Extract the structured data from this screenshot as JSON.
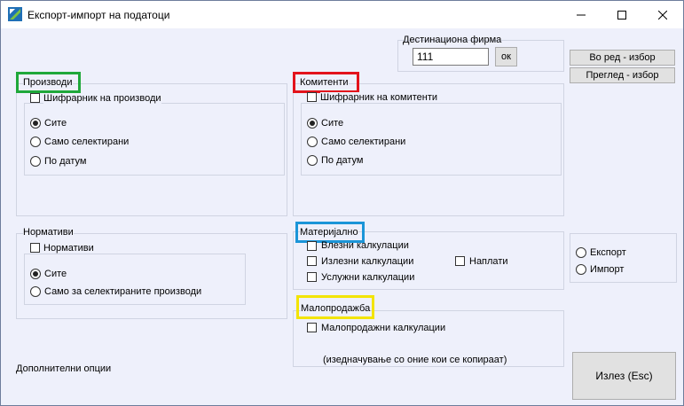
{
  "window": {
    "title": "Експорт-импорт на податоци",
    "icon": "app-logo-icon"
  },
  "destination": {
    "label": "Дестинациона фирма",
    "value": "111",
    "ok_label": "ок"
  },
  "side_buttons": {
    "row_select": "Во ред - избор",
    "preview_select": "Преглед - избор"
  },
  "products": {
    "title": "Производи",
    "checkbox": "Шифрарник на производи",
    "options": [
      "Сите",
      "Само селектирани",
      "По датум"
    ],
    "selected": "Сите"
  },
  "partners": {
    "title": "Комитенти",
    "checkbox": "Шифрарник на комитенти",
    "options": [
      "Сите",
      "Само селектирани",
      "По датум"
    ],
    "selected": "Сите"
  },
  "norms": {
    "title": "Нормативи",
    "checkbox": "Нормативи",
    "options": [
      "Сите",
      "Само за селектираните производи"
    ],
    "selected": "Сите"
  },
  "material": {
    "title": "Материјално",
    "items": [
      "Влезни калкулации",
      "Излезни калкулации",
      "Услужни калкулации",
      "Наплати"
    ]
  },
  "retail": {
    "title": "Малопродажба",
    "checkbox": "Малопродажни калкулации",
    "note": "(изедначување со оние кои се копираат)"
  },
  "direction": {
    "options": [
      "Експорт",
      "Импорт"
    ]
  },
  "additional_options": "Дополнителни опции",
  "exit_label": "Излез (Esc)",
  "highlight_colors": {
    "products": "#1fa83a",
    "partners": "#e3131b",
    "material": "#1b95d8",
    "retail": "#f3e400"
  }
}
